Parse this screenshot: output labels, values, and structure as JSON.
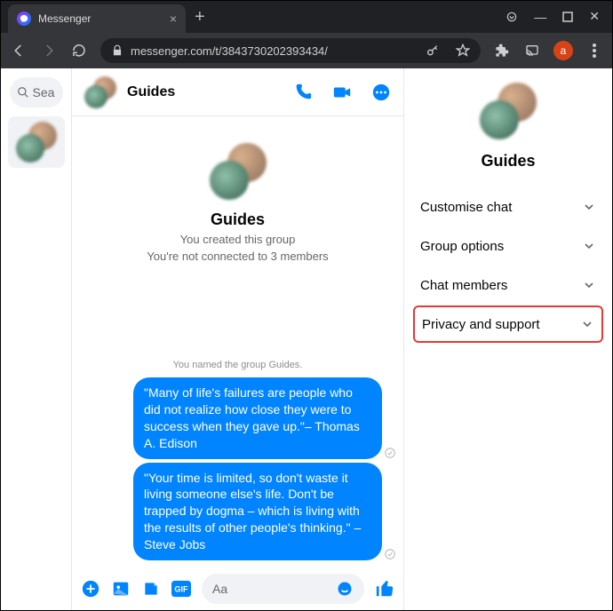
{
  "browser": {
    "tab_title": "Messenger",
    "url": "messenger.com/t/3843730202393434/",
    "profile_letter": "a"
  },
  "sidebar": {
    "search_placeholder": "Sea"
  },
  "chat": {
    "title": "Guides",
    "group_name": "Guides",
    "created_line": "You created this group",
    "not_connected_line": "You're not connected to 3 members",
    "named_line": "You named the group Guides.",
    "messages": [
      {
        "text": "\"Many of life's failures are people who did not realize how close they were to success when they gave up.\"– Thomas A. Edison"
      },
      {
        "text": "\"Your time is limited, so don't waste it living someone else's life. Don't be trapped by dogma – which is living with the results of other people's thinking.\" – Steve Jobs"
      }
    ],
    "composer_placeholder": "Aa"
  },
  "right_panel": {
    "title": "Guides",
    "sections": [
      {
        "label": "Customise chat"
      },
      {
        "label": "Group options"
      },
      {
        "label": "Chat members"
      },
      {
        "label": "Privacy and support",
        "highlight": true
      }
    ]
  }
}
